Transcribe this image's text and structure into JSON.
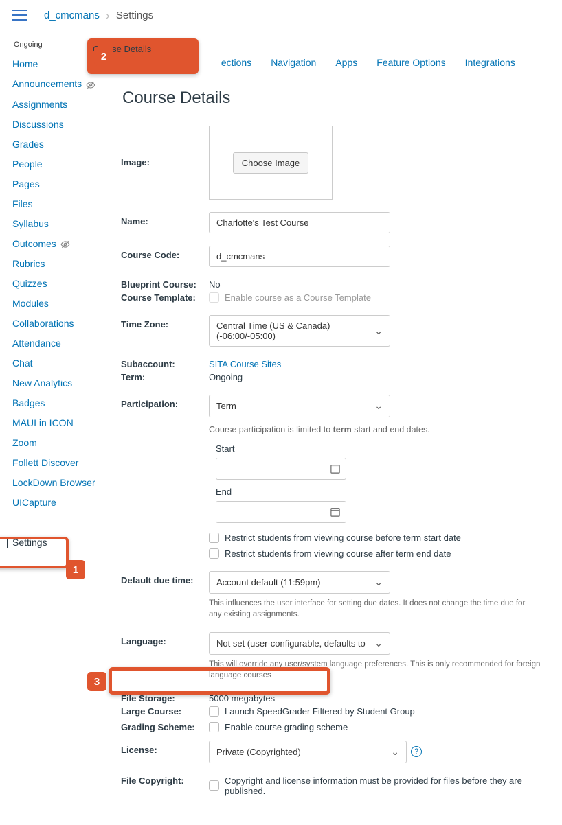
{
  "breadcrumb": {
    "course_link": "d_cmcmans",
    "page": "Settings"
  },
  "sidebar": {
    "term_label": "Ongoing",
    "items": [
      {
        "label": "Home",
        "hidden_icon": false
      },
      {
        "label": "Announcements",
        "hidden_icon": true
      },
      {
        "label": "Assignments",
        "hidden_icon": false
      },
      {
        "label": "Discussions",
        "hidden_icon": false
      },
      {
        "label": "Grades",
        "hidden_icon": false
      },
      {
        "label": "People",
        "hidden_icon": false
      },
      {
        "label": "Pages",
        "hidden_icon": false
      },
      {
        "label": "Files",
        "hidden_icon": false
      },
      {
        "label": "Syllabus",
        "hidden_icon": false
      },
      {
        "label": "Outcomes",
        "hidden_icon": true
      },
      {
        "label": "Rubrics",
        "hidden_icon": false
      },
      {
        "label": "Quizzes",
        "hidden_icon": false
      },
      {
        "label": "Modules",
        "hidden_icon": false
      },
      {
        "label": "Collaborations",
        "hidden_icon": false
      },
      {
        "label": "Attendance",
        "hidden_icon": false
      },
      {
        "label": "Chat",
        "hidden_icon": false
      },
      {
        "label": "New Analytics",
        "hidden_icon": false
      },
      {
        "label": "Badges",
        "hidden_icon": false
      },
      {
        "label": "MAUI in ICON",
        "hidden_icon": false
      },
      {
        "label": "Zoom",
        "hidden_icon": false
      },
      {
        "label": "Follett Discover",
        "hidden_icon": false
      },
      {
        "label": "LockDown Browser",
        "hidden_icon": false
      },
      {
        "label": "UICapture",
        "hidden_icon": false
      }
    ],
    "active_item": "Settings"
  },
  "tabs": {
    "items": [
      "Course Details",
      "Sections",
      "Navigation",
      "Apps",
      "Feature Options",
      "Integrations"
    ],
    "active": "Course Details",
    "partial_label": "ections"
  },
  "heading": "Course Details",
  "form": {
    "image": {
      "label": "Image:",
      "button": "Choose Image"
    },
    "name": {
      "label": "Name:",
      "value": "Charlotte's Test Course"
    },
    "course_code": {
      "label": "Course Code:",
      "value": "d_cmcmans"
    },
    "blueprint": {
      "label": "Blueprint Course:",
      "value": "No"
    },
    "template": {
      "label": "Course Template:",
      "checkbox": "Enable course as a Course Template"
    },
    "timezone": {
      "label": "Time Zone:",
      "value": "Central Time (US & Canada) (-06:00/-05:00)"
    },
    "subaccount": {
      "label": "Subaccount:",
      "value": "SITA Course Sites"
    },
    "term": {
      "label": "Term:",
      "value": "Ongoing"
    },
    "participation": {
      "label": "Participation:",
      "value": "Term",
      "helper_a": "Course participation is limited to ",
      "helper_b": "term",
      "helper_c": " start and end dates.",
      "start_label": "Start",
      "end_label": "End",
      "restrict_before": "Restrict students from viewing course before term start date",
      "restrict_after": "Restrict students from viewing course after term end date"
    },
    "default_due": {
      "label": "Default due time:",
      "value": "Account default (11:59pm)",
      "helper": "This influences the user interface for setting due dates. It does not change the time due for any existing assignments."
    },
    "language": {
      "label": "Language:",
      "value": "Not set (user-configurable, defaults to English (U",
      "helper": "This will override any user/system language preferences. This is only recommended for foreign language courses"
    },
    "file_storage": {
      "label": "File Storage:",
      "value": "5000 megabytes"
    },
    "large_course": {
      "label": "Large Course:",
      "checkbox": "Launch SpeedGrader Filtered by Student Group"
    },
    "grading_scheme": {
      "label": "Grading Scheme:",
      "checkbox": "Enable course grading scheme"
    },
    "license": {
      "label": "License:",
      "value": "Private (Copyrighted)"
    },
    "file_copyright": {
      "label": "File Copyright:",
      "checkbox": "Copyright and license information must be provided for files before they are published."
    }
  },
  "annotations": {
    "n1": "1",
    "n2": "2",
    "n3": "3"
  }
}
